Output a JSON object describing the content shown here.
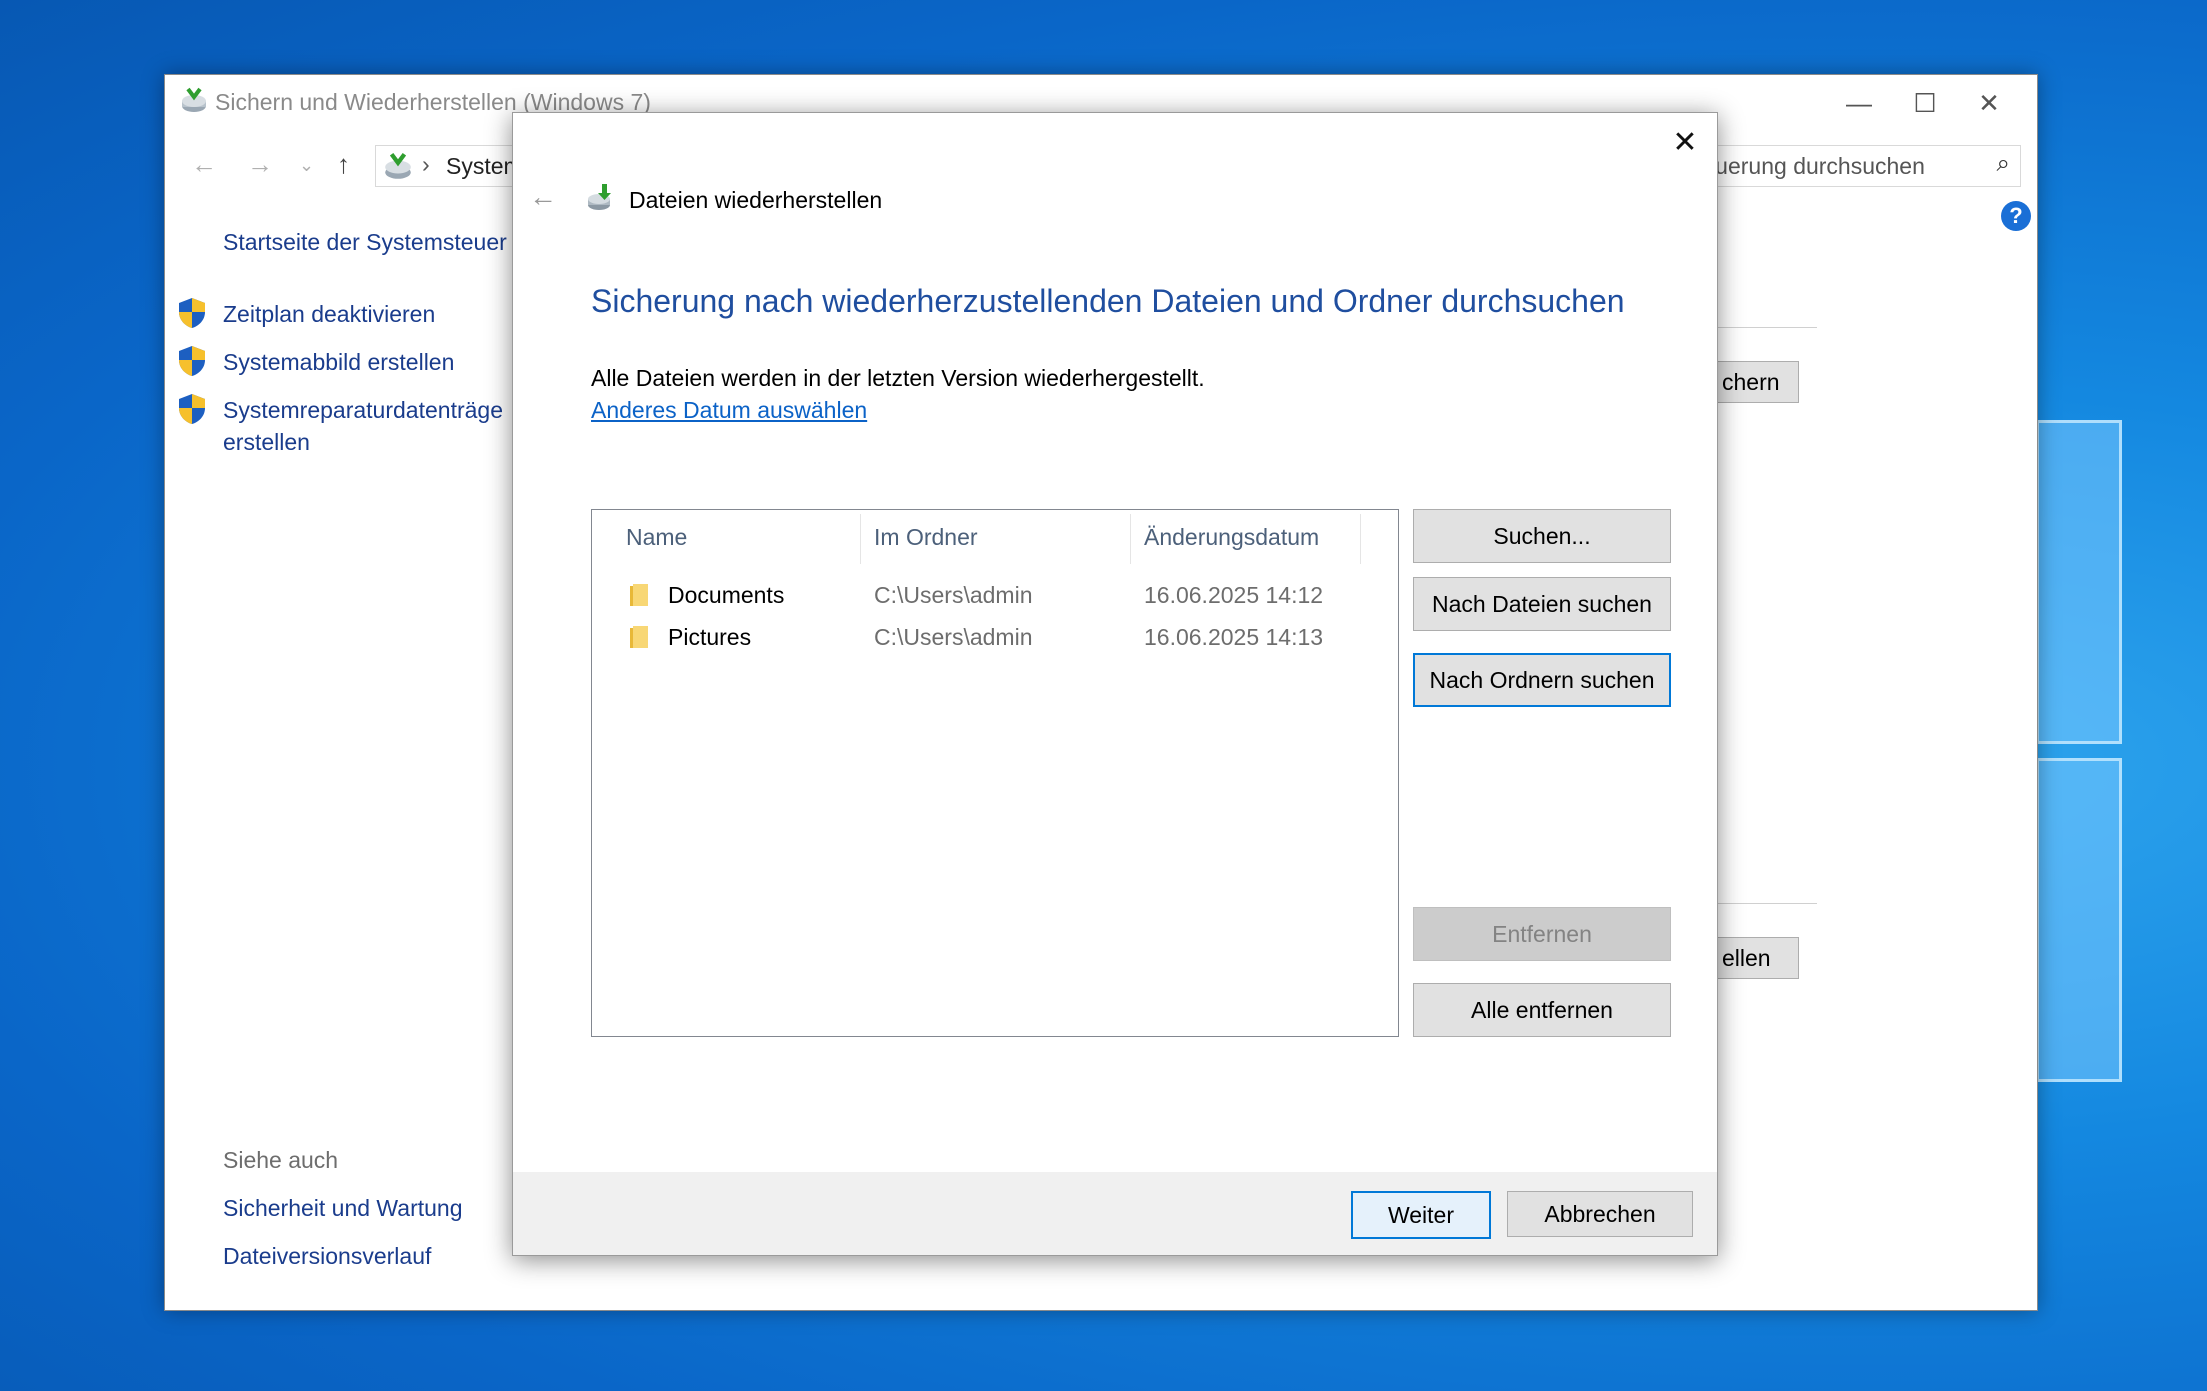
{
  "main_window": {
    "title": "Sichern und Wiederherstellen (Windows 7)",
    "address": "System",
    "search_placeholder": "teuerung durchsuchen",
    "sidebar": {
      "home_link": "Startseite der Systemsteuer",
      "tasks": [
        "Zeitplan deaktivieren",
        "Systemabbild erstellen",
        "Systemreparaturdatenträge",
        "erstellen"
      ],
      "see_also_heading": "Siehe auch",
      "see_also": [
        "Sicherheit und Wartung",
        "Dateiversionsverlauf"
      ]
    },
    "bg_buttons": [
      "chern",
      "ellen"
    ]
  },
  "dialog": {
    "title": "Dateien wiederherstellen",
    "heading": "Sicherung nach wiederherzustellenden Dateien und Ordner durchsuchen",
    "info": "Alle Dateien werden in der letzten Version wiederhergestellt.",
    "link": "Anderes Datum auswählen",
    "columns": [
      "Name",
      "Im Ordner",
      "Änderungsdatum"
    ],
    "rows": [
      {
        "name": "Documents",
        "folder": "C:\\Users\\admin",
        "date": "16.06.2025 14:12"
      },
      {
        "name": "Pictures",
        "folder": "C:\\Users\\admin",
        "date": "16.06.2025 14:13"
      }
    ],
    "buttons": {
      "search": "Suchen...",
      "search_files": "Nach Dateien suchen",
      "search_folders": "Nach Ordnern suchen",
      "remove": "Entfernen",
      "remove_all": "Alle entfernen"
    },
    "footer": {
      "next": "Weiter",
      "cancel": "Abbrechen"
    }
  }
}
